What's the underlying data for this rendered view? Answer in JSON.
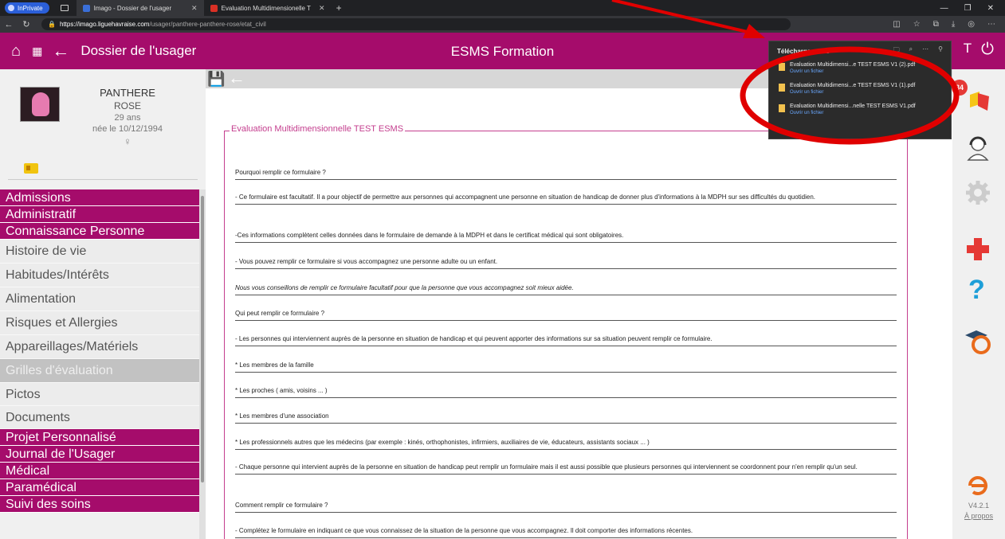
{
  "browser": {
    "inprivate": "InPrivate",
    "tabs": [
      {
        "title": "Imago - Dossier de l'usager"
      },
      {
        "title": "Evaluation Multidimensionelle T"
      }
    ],
    "url_host": "https://imago.liguehavraise.com",
    "url_path": "/usager/panthere-panthere-rose/etat_civil"
  },
  "header": {
    "title": "Dossier de l'usager",
    "center": "ESMS Formation"
  },
  "patient": {
    "nom": "PANTHERE",
    "prenom": "ROSE",
    "age": "29 ans",
    "naissance": "née le 10/12/1994",
    "sexe": "♀"
  },
  "menu": [
    {
      "label": "Admissions",
      "type": "main"
    },
    {
      "label": "Administratif",
      "type": "main"
    },
    {
      "label": "Connaissance Personne",
      "type": "main"
    },
    {
      "label": "Histoire de vie",
      "type": "sub"
    },
    {
      "label": "Habitudes/Intérêts",
      "type": "sub"
    },
    {
      "label": "Alimentation",
      "type": "sub"
    },
    {
      "label": "Risques et Allergies",
      "type": "sub"
    },
    {
      "label": "Appareillages/Matériels",
      "type": "sub"
    },
    {
      "label": "Grilles d'évaluation",
      "type": "sub-selected"
    },
    {
      "label": "Pictos",
      "type": "sub"
    },
    {
      "label": "Documents",
      "type": "sub"
    },
    {
      "label": "Projet Personnalisé",
      "type": "main"
    },
    {
      "label": "Journal de l'Usager",
      "type": "main"
    },
    {
      "label": "Médical",
      "type": "main"
    },
    {
      "label": "Paramédical",
      "type": "main"
    },
    {
      "label": "Suivi des soins",
      "type": "main"
    }
  ],
  "form": {
    "legend": "Evaluation Multidimensionnelle TEST ESMS",
    "rows": [
      "Pourquoi remplir ce formulaire ?",
      "- Ce formulaire est facultatif. Il a pour objectif de permettre aux personnes qui accompagnent une personne en situation de handicap de donner plus d'informations à la MDPH sur ses difficultés du quotidien.",
      "-Ces informations complètent celles données dans le formulaire de demande à la MDPH et dans le certificat médical qui sont obligatoires.",
      "- Vous pouvez remplir ce formulaire si vous accompagnez une personne adulte ou un enfant.",
      "Nous vous conseillons de remplir ce formulaire facultatif pour que la personne que vous accompagnez soit mieux aidée.",
      "Qui peut remplir ce formulaire ?",
      "- Les personnes qui interviennent auprès de la personne en situation de handicap et qui peuvent apporter des informations sur sa situation peuvent remplir ce formulaire.",
      "* Les membres de la famille",
      "* Les proches ( amis, voisins ... )",
      "* Les membres d'une association",
      "* Les professionnels autres que les médecins (par exemple : kinés, orthophonistes, infirmiers, auxiliaires de vie, éducateurs, assistants sociaux ... )",
      "- Chaque personne qui intervient auprès de la personne en situation de handicap peut remplir un formulaire mais il est aussi possible que plusieurs personnes qui interviennent se coordonnent pour n'en remplir qu'un seul.",
      "Comment remplir ce formulaire ?",
      "- Complétez le formulaire en indiquant ce que vous connaissez de la situation de la personne que vous accompagnez. Il doit comporter des informations récentes."
    ]
  },
  "rightbar": {
    "badge": "34",
    "version": "V4.2.1",
    "apropos": "À propos"
  },
  "downloads": {
    "title": "Téléchargements",
    "items": [
      {
        "name": "Evaluation Multidimensi...e TEST ESMS V1 (2).pdf",
        "action": "Ouvrir un fichier"
      },
      {
        "name": "Evaluation Multidimensi...e TEST ESMS V1 (1).pdf",
        "action": "Ouvrir un fichier"
      },
      {
        "name": "Evaluation Multidimensi...nelle TEST ESMS V1.pdf",
        "action": "Ouvrir un fichier"
      }
    ]
  },
  "colors": {
    "brand": "#a50c6b",
    "annotation": "#e00000"
  }
}
